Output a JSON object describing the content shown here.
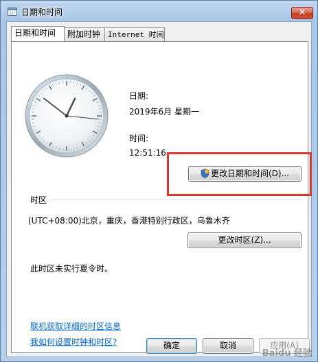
{
  "window": {
    "title": "日期和时间",
    "close_symbol": "✕"
  },
  "tabs": [
    {
      "label": "日期和时间",
      "active": true
    },
    {
      "label": "附加时钟",
      "active": false
    },
    {
      "label": "Internet 时间",
      "active": false
    }
  ],
  "datetime": {
    "date_label": "日期:",
    "date_value": "2019年6月 星期一",
    "time_label": "时间:",
    "time_value": "12:51:16",
    "change_button": "更改日期和时间(D)...",
    "change_button_mnemonic": "D"
  },
  "timezone": {
    "section_label": "时区",
    "value": "(UTC+08:00)北京，重庆，香港特别行政区，乌鲁木齐",
    "change_button": "更改时区(Z)...",
    "dst_note": "此时区未实行夏令时。"
  },
  "links": {
    "online_info": "联机获取详细的时区信息",
    "how_to": "我如何设置时钟和时区?"
  },
  "footer": {
    "ok": "确定",
    "cancel": "取消",
    "apply": "应用(A)"
  },
  "clock": {
    "hour": 12,
    "minute": 51,
    "second": 16
  },
  "watermark": "Baidu 经验",
  "colors": {
    "highlight": "#d9392e",
    "link": "#0066cc",
    "close": "#c23a23"
  }
}
